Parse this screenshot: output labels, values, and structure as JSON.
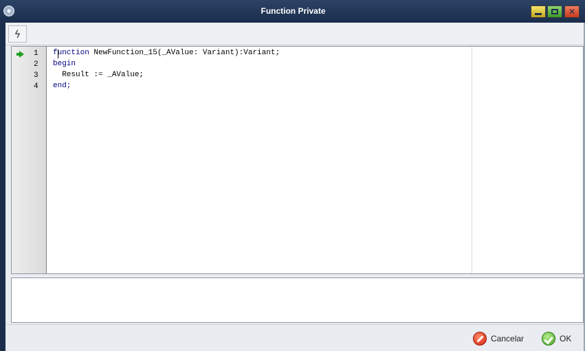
{
  "window": {
    "title": "Function Private",
    "close_glyph": "✕"
  },
  "toolbar": {
    "tool_glyph": "ϟ",
    "tool_icon": "lightning-icon"
  },
  "editor": {
    "lines": [
      {
        "number": "1",
        "keyword": "function",
        "rest": " NewFunction_15(_AValue: Variant):Variant;"
      },
      {
        "number": "2",
        "keyword": "begin",
        "rest": ""
      },
      {
        "number": "3",
        "keyword": "",
        "rest": "  Result := _AValue;"
      },
      {
        "number": "4",
        "keyword": "end;",
        "rest": ""
      }
    ],
    "current_line": 1,
    "colors": {
      "keyword": "#000080",
      "current_line_arrow": "#1ea01e"
    }
  },
  "footer": {
    "cancel_label": "Cancelar",
    "ok_label": "OK"
  }
}
